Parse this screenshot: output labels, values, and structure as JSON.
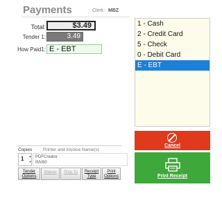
{
  "header": {
    "title": "Payments",
    "clerk_label": "Clerk:",
    "clerk_value": "MBZ"
  },
  "fields": {
    "total_label": "Total:",
    "total_value": "$3.49",
    "tender_label": "Tender 1:",
    "tender_value": "3.49",
    "how_paid_label": "How Paid1:",
    "how_paid_value": "E - EBT"
  },
  "payment_methods": [
    "1 - Cash",
    "2 - Credit Card",
    "5 - Check",
    "0 - Debit Card",
    "E - EBT"
  ],
  "selected_payment": "E - EBT",
  "actions": {
    "cancel_label": "Cancel",
    "print_label": "Print Receipt"
  },
  "print": {
    "copies_label": "Copies",
    "printer_label": "Printer and Invoice Name(s)",
    "copies_value": "1",
    "printers": [
      "PDFCreator",
      "INV80"
    ]
  },
  "toolbar": {
    "tender_options": [
      "Tender",
      "Options"
    ],
    "waiver": "Waiver",
    "ship_to": "Ship To",
    "receipt_type": [
      "Receipt",
      "Type"
    ],
    "print_options": [
      "Print",
      "Options"
    ]
  },
  "colors": {
    "cancel": "#df3a1c",
    "print": "#3ea83a",
    "selected": "#1e7fd8",
    "list_bg": "#fdfcea"
  }
}
